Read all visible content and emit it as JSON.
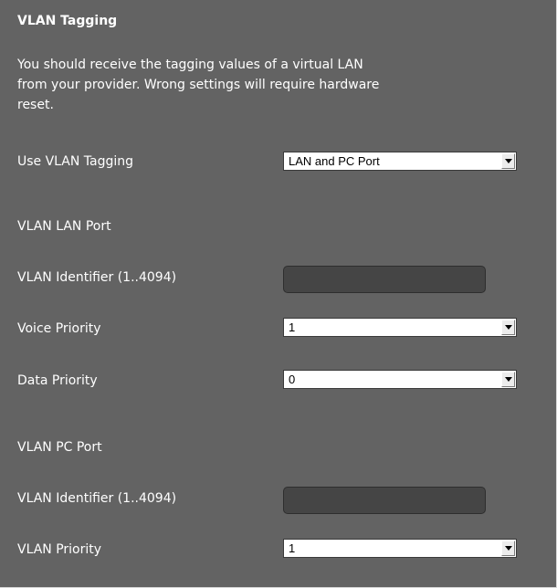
{
  "section": {
    "title": "VLAN Tagging",
    "description_lines": [
      "You should receive the tagging values of a virtual LAN",
      "from your provider. Wrong settings will require hardware",
      "reset."
    ]
  },
  "use_vlan_tagging": {
    "label": "Use VLAN Tagging",
    "value": "LAN and PC Port"
  },
  "lan_port": {
    "heading": "VLAN LAN Port",
    "identifier": {
      "label": "VLAN Identifier (1..4094)",
      "value": ""
    },
    "voice_priority": {
      "label": "Voice Priority",
      "value": "1"
    },
    "data_priority": {
      "label": "Data Priority",
      "value": "0"
    }
  },
  "pc_port": {
    "heading": "VLAN PC Port",
    "identifier": {
      "label": "VLAN Identifier (1..4094)",
      "value": ""
    },
    "vlan_priority": {
      "label": "VLAN Priority",
      "value": "1"
    }
  },
  "colors": {
    "panel_background": "#636363",
    "text": "#ffffff",
    "input_disabled": "#454545",
    "select_background": "#ffffff"
  },
  "icons": {
    "dropdown_arrow": "chevron-down-icon"
  }
}
